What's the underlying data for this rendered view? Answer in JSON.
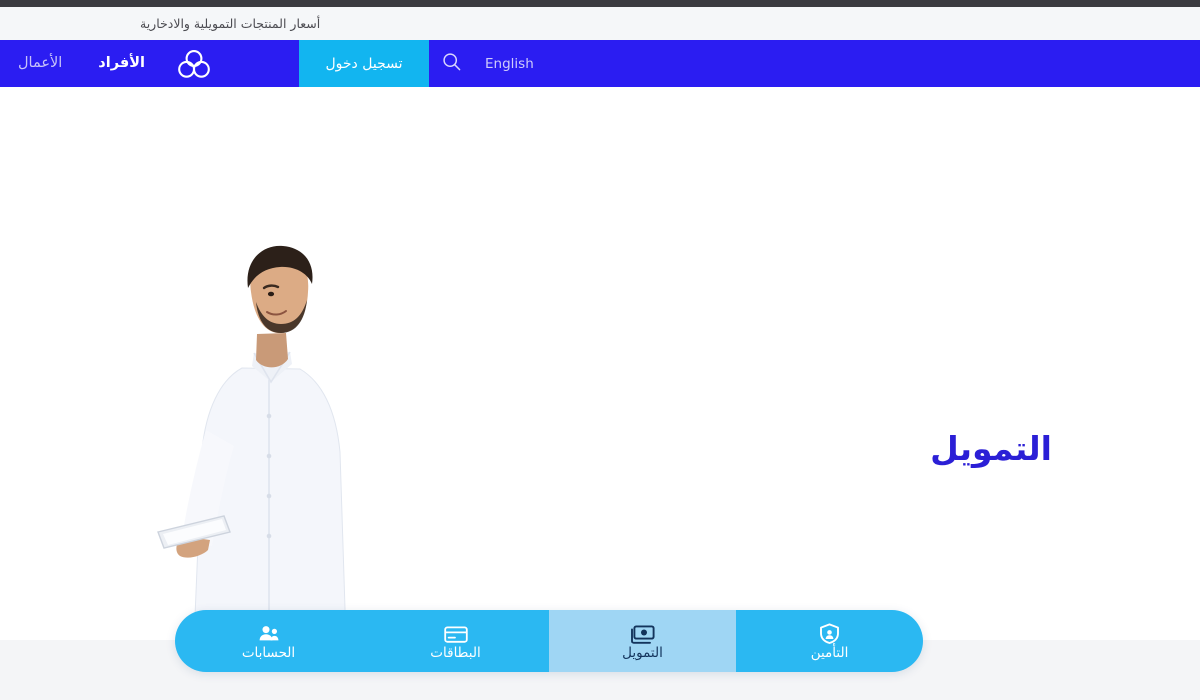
{
  "page": {
    "language": "ar",
    "direction": "rtl",
    "hero_title": "التمويل",
    "brand_name": "Riyad Bank"
  },
  "colors": {
    "nav_blue": "#2b1df2",
    "accent_cyan": "#12b5f0",
    "tabbar_cyan": "#2bb8f2",
    "tab_active": "#9fd6f4",
    "heading_blue": "#2b1fd6",
    "utility_bg": "#f5f7f9",
    "bottom_band": "#f4f5f7",
    "chrome": "#3b3b40"
  },
  "utility_bar": {
    "link_label": "أسعار المنتجات التمويلية والادخارية"
  },
  "navbar": {
    "logo_icon": "trefoil-three-circles-logo",
    "items": [
      {
        "label": "الأفراد",
        "active": true
      },
      {
        "label": "الأعمال",
        "active": false
      }
    ],
    "search_icon": "search-icon",
    "language_toggle": "English",
    "login_label": "تسجيل دخول"
  },
  "hero": {
    "title": "التمويل",
    "image_alt": "رجل يرتدي ثوباً أبيض يحمل جهازاً لوحياً"
  },
  "product_tabs": [
    {
      "label": "الحسابات",
      "icon": "people-accounts-icon",
      "active": false
    },
    {
      "label": "البطاقات",
      "icon": "credit-card-icon",
      "active": false
    },
    {
      "label": "التمويل",
      "icon": "banknote-cash-icon",
      "active": true
    },
    {
      "label": "التأمين",
      "icon": "shield-person-icon",
      "active": false
    }
  ]
}
